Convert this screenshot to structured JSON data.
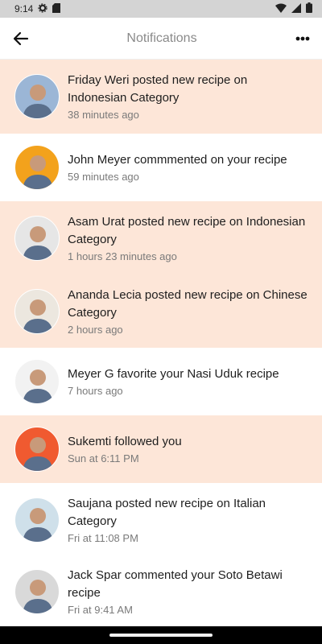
{
  "status_bar": {
    "time": "9:14"
  },
  "app_bar": {
    "title": "Notifications"
  },
  "notifications": [
    {
      "message": "Friday Weri posted new recipe on Indonesian Category",
      "time": "38 minutes ago",
      "unread": true,
      "avatar_color": "#9bb6d6"
    },
    {
      "message": "John Meyer commmented on your recipe",
      "time": "59 minutes ago",
      "unread": false,
      "avatar_color": "#f3a21c"
    },
    {
      "message": "Asam Urat posted new recipe on Indonesian Category",
      "time": "1 hours 23 minutes ago",
      "unread": true,
      "avatar_color": "#e6e6e6"
    },
    {
      "message": "Ananda Lecia posted new recipe on Chinese Category",
      "time": "2 hours ago",
      "unread": true,
      "avatar_color": "#ece7df"
    },
    {
      "message": "Meyer G favorite your Nasi Uduk recipe",
      "time": "7 hours ago",
      "unread": false,
      "avatar_color": "#f2f2f2"
    },
    {
      "message": "Sukemti followed you",
      "time": "Sun at 6:11 PM",
      "unread": true,
      "avatar_color": "#f05a30"
    },
    {
      "message": "Saujana posted new recipe on Italian Category",
      "time": "Fri at 11:08 PM",
      "unread": false,
      "avatar_color": "#cfe0ea"
    },
    {
      "message": "Jack Spar commented your Soto Betawi recipe",
      "time": "Fri at 9:41 AM",
      "unread": false,
      "avatar_color": "#d9d9d9"
    }
  ]
}
